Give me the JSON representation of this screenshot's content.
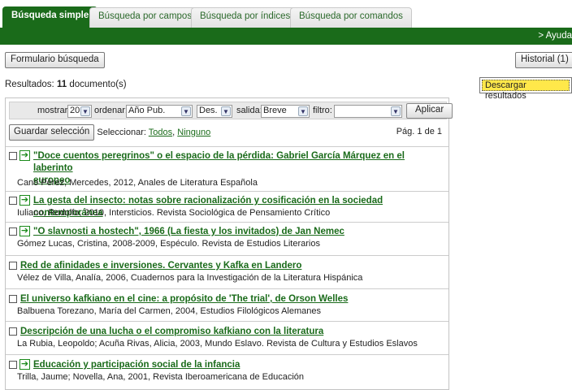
{
  "tabs": [
    {
      "label": "Búsqueda simple",
      "active": true
    },
    {
      "label": "Búsqueda por campos",
      "active": false
    },
    {
      "label": "Búsqueda por índices",
      "active": false
    },
    {
      "label": "Búsqueda por comandos",
      "active": false
    }
  ],
  "topbar": {
    "ayuda": "> Ayuda"
  },
  "toolbar": {
    "form_button": "Formulario búsqueda",
    "history_button": "Historial (1)"
  },
  "results": {
    "prefix": "Resultados:",
    "count": "11",
    "suffix": "documento(s)"
  },
  "download_button": "Descargar resultados",
  "options": {
    "mostrar_label": "mostrar:",
    "mostrar_value": "20",
    "ordenar_label": "ordenar:",
    "ordenar_value": "Año Pub.",
    "dir_value": "Des.",
    "salida_label": "salida:",
    "salida_value": "Breve",
    "filtro_label": "filtro:",
    "filtro_value": "",
    "apply_button": "Aplicar"
  },
  "selection": {
    "save_button": "Guardar selección",
    "select_label": "Seleccionar:",
    "all_link": "Todos",
    "none_link": "Ninguno"
  },
  "pagination": "Pág. 1 de 1",
  "items": [
    {
      "title": "\"Doce cuentos peregrinos\" o el espacio de la pérdida: Gabriel García Márquez en el laberinto",
      "title2": "europeo",
      "meta": "Cano Pérez, Mercedes,  2012,  Anales de Literatura Española",
      "link": true
    },
    {
      "title": "La gesta del insecto: notas sobre racionalización y cosificación en la sociedad contemporánea",
      "title2": "",
      "meta": "Iuliano, Rodolfo,  2010,  Intersticios. Revista Sociológica de Pensamiento Crítico",
      "link": true
    },
    {
      "title": "\"O slavnosti a hostech\", 1966 (La fiesta y los invitados) de Jan Nemec",
      "title2": "",
      "meta": "Gómez Lucas, Cristina,  2008-2009,  Espéculo. Revista de Estudios Literarios",
      "link": true
    },
    {
      "title": "Red de afinidades e inversiones. Cervantes y Kafka en Landero",
      "title2": "",
      "meta": "Vélez de Villa, Analía,  2006,  Cuadernos para la Investigación de la Literatura Hispánica",
      "link": false
    },
    {
      "title": "El universo kafkiano en el cine: a propósito de 'The trial', de Orson Welles",
      "title2": "",
      "meta": "Balbuena Torezano, María del Carmen,  2004,  Estudios Filológicos Alemanes",
      "link": false
    },
    {
      "title": "Descripción de una lucha o el compromiso kafkiano con la literatura",
      "title2": "",
      "meta": "La Rubia, Leopoldo; Acuña Rivas, Alicia,  2003,  Mundo Eslavo. Revista de Cultura y Estudios Eslavos",
      "link": false
    },
    {
      "title": "Educación y participación social de la infancia",
      "title2": "",
      "meta": "Trilla, Jaume; Novella, Ana,  2001,  Revista Iberoamericana de Educación",
      "link": true
    }
  ]
}
